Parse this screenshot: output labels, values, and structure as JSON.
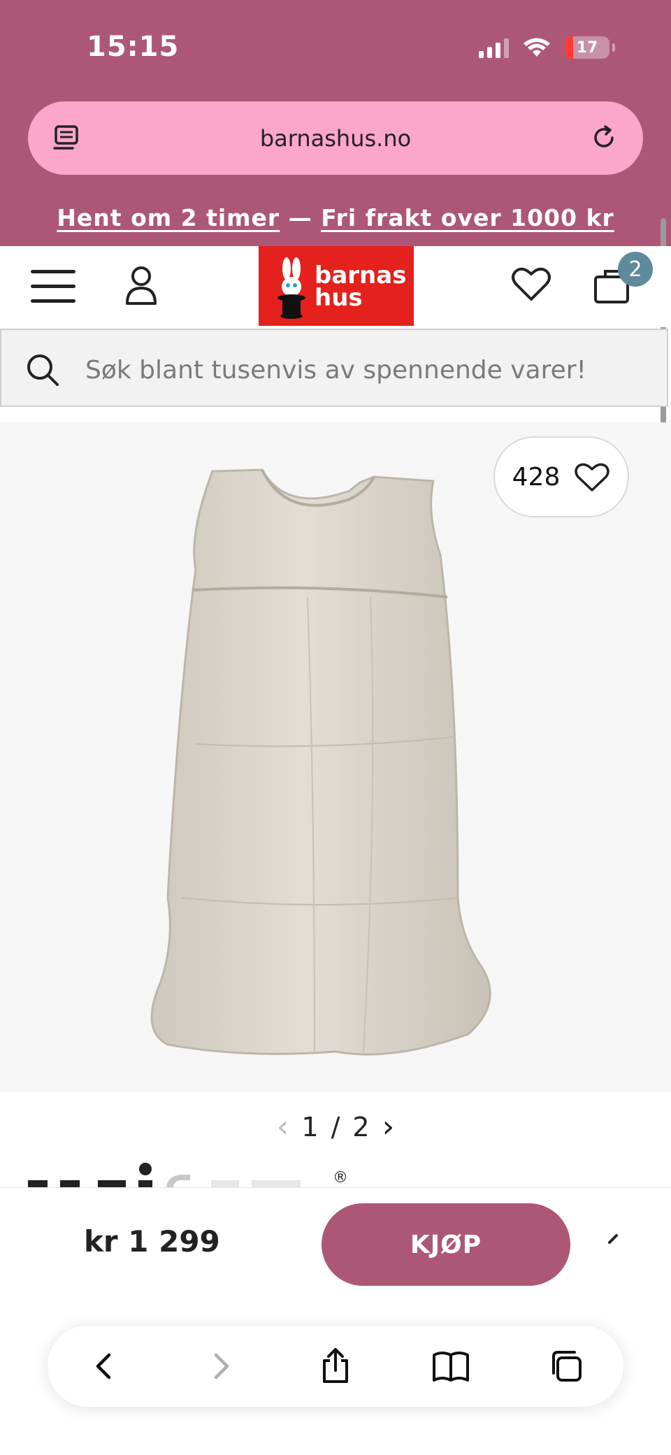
{
  "status": {
    "time": "15:15",
    "battery": "17"
  },
  "browser": {
    "url": "barnashus.no",
    "left_icon": "tab-overview-icon",
    "right_icon": "reload-icon"
  },
  "promo": {
    "part1": "Hent om 2 timer",
    "separator": " — ",
    "part2": "Fri frakt over 1000 kr"
  },
  "header": {
    "logo_line1": "barnas",
    "logo_line2": "hus",
    "cart_count": "2",
    "icons": [
      "menu-icon",
      "user-icon",
      "heart-icon",
      "cart-icon"
    ]
  },
  "search": {
    "placeholder": "Søk blant tusenvis av spennende varer!"
  },
  "product": {
    "likes": "428",
    "pager": {
      "current": "1",
      "separator": "/",
      "total": "2"
    },
    "price": "kr 1 299",
    "buy_label": "KJØP",
    "image_color": "#d9d3ca"
  },
  "toolbar": {
    "icons": [
      "back-icon",
      "forward-icon",
      "share-icon",
      "bookmarks-icon",
      "tabs-icon"
    ]
  },
  "colors": {
    "brand": "#ad5777",
    "url_bar": "#fca6c9",
    "logo_red": "#e4211c",
    "badge": "#5f8a9c"
  }
}
